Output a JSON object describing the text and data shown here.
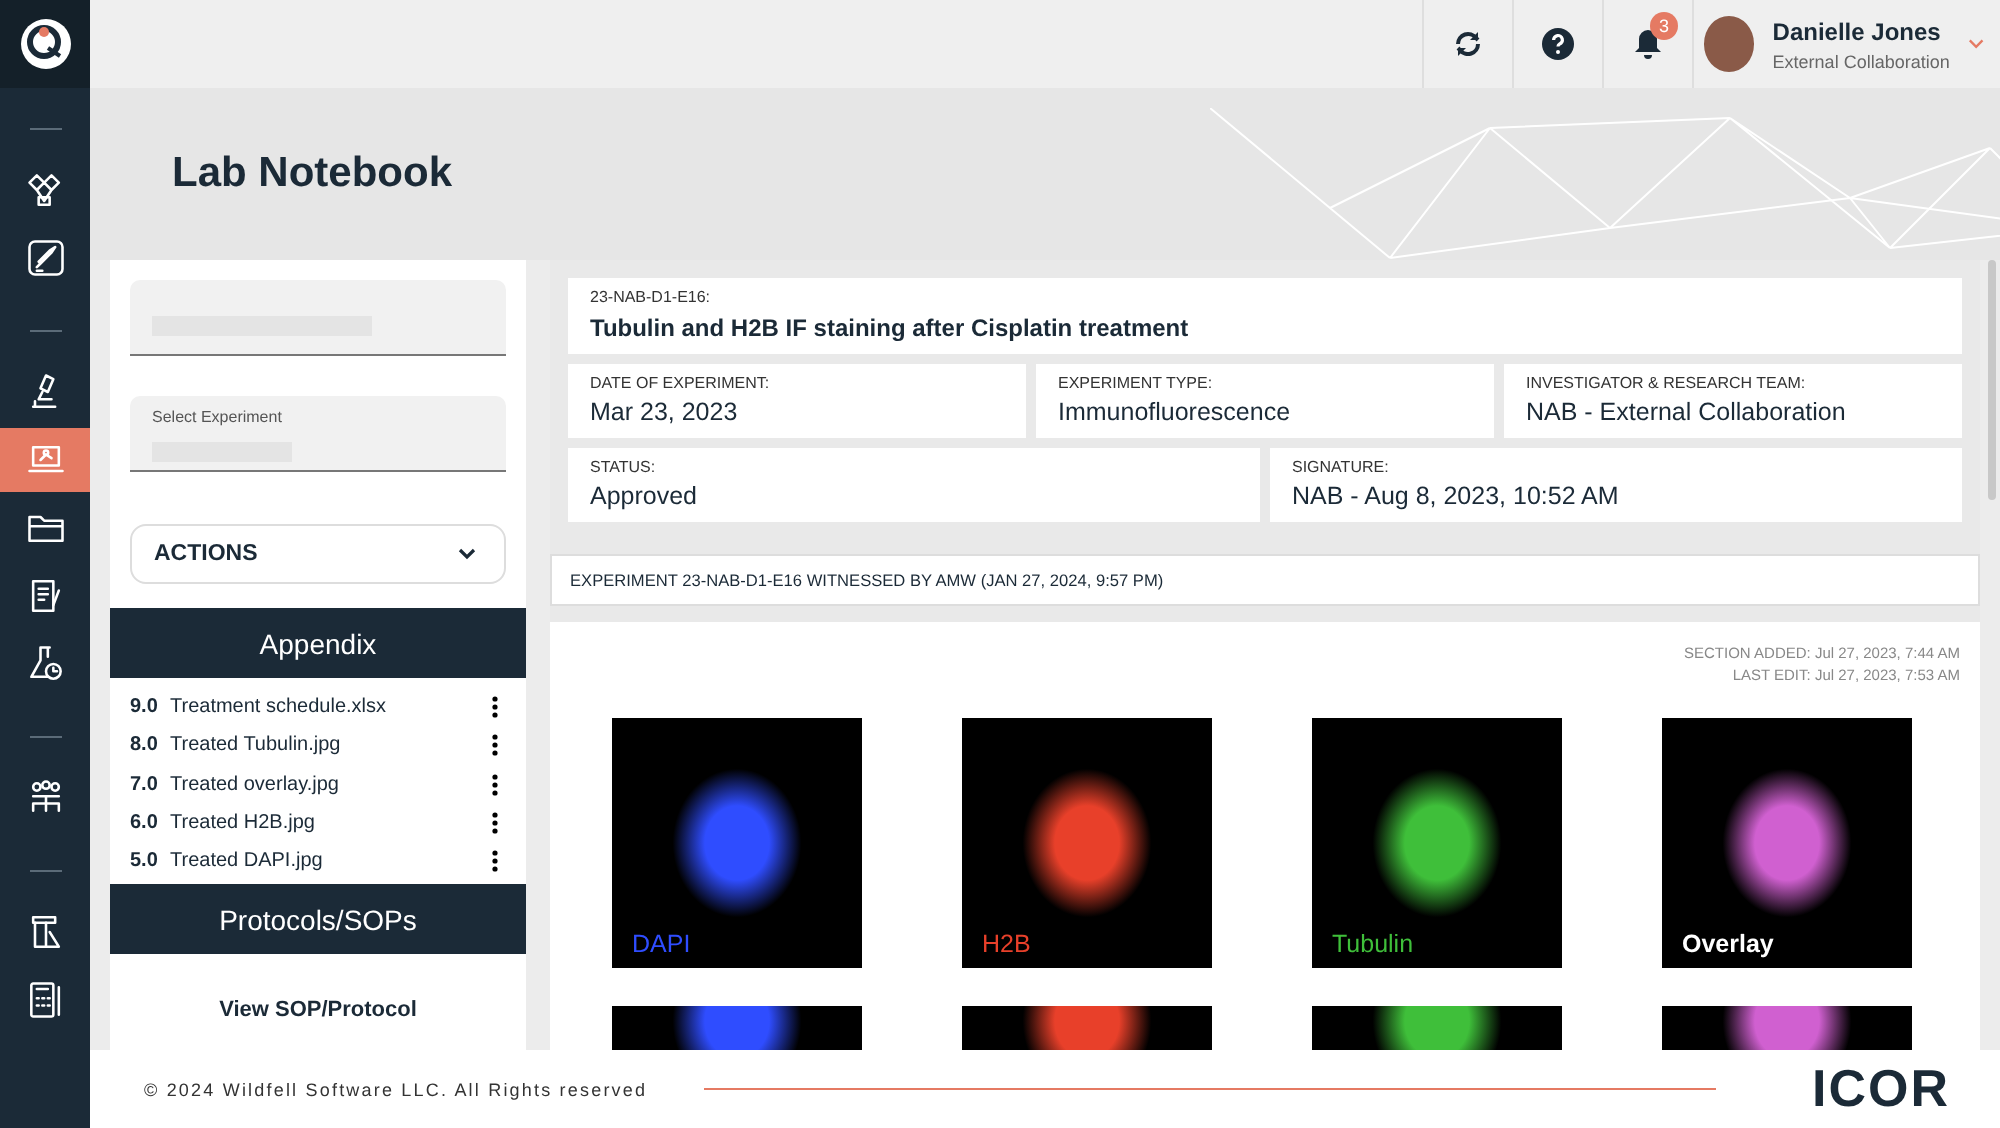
{
  "sidebar": {
    "groups": [
      [
        {
          "selected": false
        },
        {
          "selected": false
        }
      ],
      [
        {
          "selected": false
        },
        {
          "selected": true
        },
        {
          "selected": false
        },
        {
          "selected": false
        },
        {
          "selected": false
        }
      ],
      [
        {
          "selected": false
        }
      ],
      [
        {
          "selected": false
        },
        {
          "selected": false
        }
      ]
    ]
  },
  "topbar": {
    "notification_count": "3",
    "user": {
      "name": "Danielle Jones",
      "role": "External Collaboration"
    }
  },
  "page": {
    "title": "Lab Notebook"
  },
  "left_panel": {
    "experiment_field": {
      "label": "Select Experiment"
    },
    "actions": "ACTIONS",
    "appendix": {
      "title": "Appendix",
      "items": [
        {
          "number": "9.0",
          "name": "Treatment schedule.xlsx"
        },
        {
          "number": "8.0",
          "name": "Treated Tubulin.jpg"
        },
        {
          "number": "7.0",
          "name": "Treated overlay.jpg"
        },
        {
          "number": "6.0",
          "name": "Treated H2B.jpg"
        },
        {
          "number": "5.0",
          "name": "Treated DAPI.jpg"
        }
      ]
    },
    "protocols": {
      "title": "Protocols/SOPs",
      "link": "View SOP/Protocol"
    }
  },
  "experiment": {
    "id": "23-NAB-D1-E16:",
    "title": "Tubulin and H2B IF staining after Cisplatin treatment",
    "fields": [
      [
        {
          "label": "DATE OF EXPERIMENT:",
          "value": "Mar 23, 2023"
        },
        {
          "label": "EXPERIMENT TYPE:",
          "value": "Immunofluorescence"
        },
        {
          "label": "INVESTIGATOR & RESEARCH TEAM:",
          "value": "NAB - External Collaboration"
        }
      ],
      [
        {
          "label": "STATUS:",
          "value": "Approved"
        },
        {
          "label": "SIGNATURE:",
          "value": "NAB - Aug 8, 2023, 10:52 AM"
        }
      ]
    ],
    "witness": "EXPERIMENT 23-NAB-D1-E16 WITNESSED BY AMW (JAN 27, 2024, 9:57 PM)"
  },
  "section": {
    "added": "SECTION ADDED: Jul 27, 2023, 7:44 AM",
    "last_edit": "LAST EDIT: Jul 27, 2023, 7:53 AM",
    "images": [
      {
        "label": "DAPI",
        "kind": "dapi"
      },
      {
        "label": "H2B",
        "kind": "h2b"
      },
      {
        "label": "Tubulin",
        "kind": "tubulin"
      },
      {
        "label": "Overlay",
        "kind": "overlay"
      },
      {
        "kind": "dapi"
      },
      {
        "kind": "h2b"
      },
      {
        "kind": "tubulin"
      },
      {
        "kind": "overlay"
      }
    ]
  },
  "footer": {
    "copyright": "© 2024 Wildfell Software LLC. All Rights reserved",
    "logo": "ICOR"
  }
}
